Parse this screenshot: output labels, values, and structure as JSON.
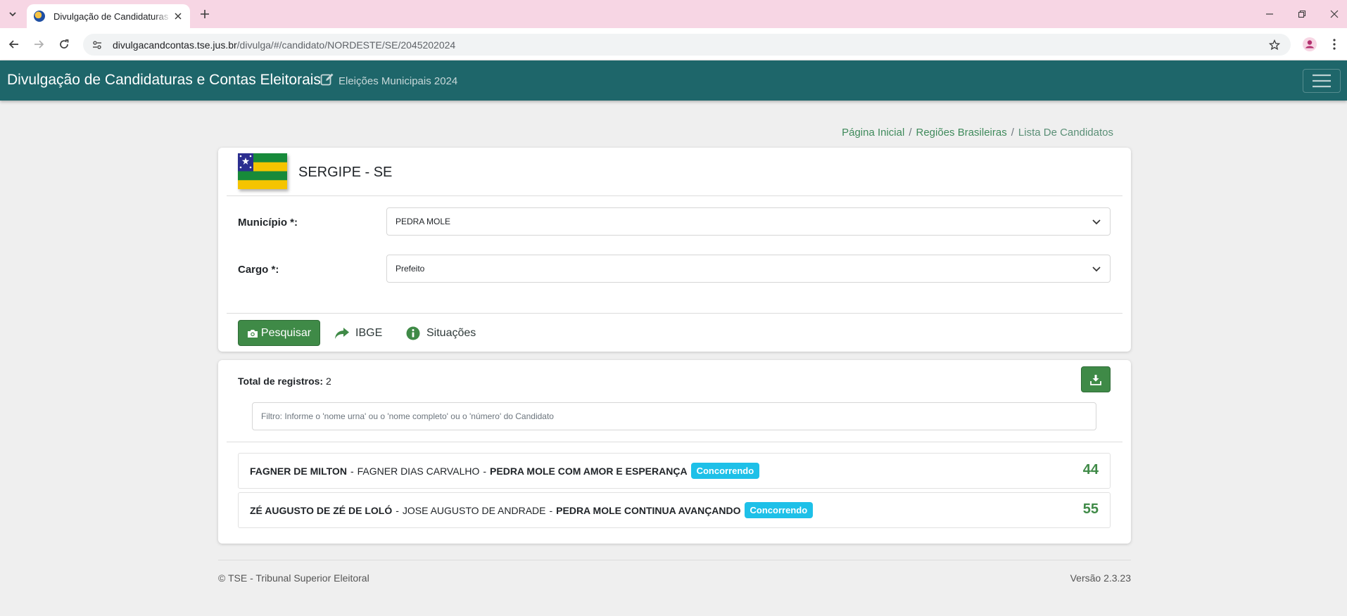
{
  "browser": {
    "tab_title": "Divulgação de Candidaturas e C",
    "url_host": "divulgacandcontas.tse.jus.br",
    "url_path": "/divulga/#/candidato/NORDESTE/SE/2045202024"
  },
  "navbar": {
    "brand": "Divulgação de Candidaturas e Contas Eleitorais",
    "election": "Eleições Municipais 2024"
  },
  "breadcrumb": {
    "items": [
      "Página Inicial",
      "Regiões Brasileiras",
      "Lista De Candidatos"
    ],
    "separator": "/"
  },
  "state": {
    "title": "SERGIPE - SE"
  },
  "form": {
    "municipio_label": "Município *:",
    "municipio_value": "PEDRA MOLE",
    "cargo_label": "Cargo *:",
    "cargo_value": "Prefeito"
  },
  "actions": {
    "search_label": "Pesquisar",
    "ibge_label": "IBGE",
    "situacoes_label": "Situações"
  },
  "results": {
    "total_label": "Total de registros:",
    "total_value": "2",
    "filter_placeholder": "Filtro: Informe o 'nome urna' ou o 'nome completo' ou o 'número' do Candidato",
    "candidates": [
      {
        "urn_name": "FAGNER DE MILTON",
        "full_name": "FAGNER DIAS CARVALHO",
        "coalition": "PEDRA MOLE COM AMOR E ESPERANÇA",
        "status": "Concorrendo",
        "number": "44"
      },
      {
        "urn_name": "ZÉ AUGUSTO DE ZÉ DE LOLÓ",
        "full_name": "JOSE AUGUSTO DE ANDRADE",
        "coalition": "PEDRA MOLE CONTINUA AVANÇANDO",
        "status": "Concorrendo",
        "number": "55"
      }
    ]
  },
  "footer": {
    "copyright": "© TSE - Tribunal Superior Eleitoral",
    "version": "Versão 2.3.23"
  },
  "colors": {
    "navbar": "#1e666a",
    "accent_green": "#3f8a47",
    "badge": "#1ec0e8",
    "tabbar": "#f7d6e4"
  }
}
